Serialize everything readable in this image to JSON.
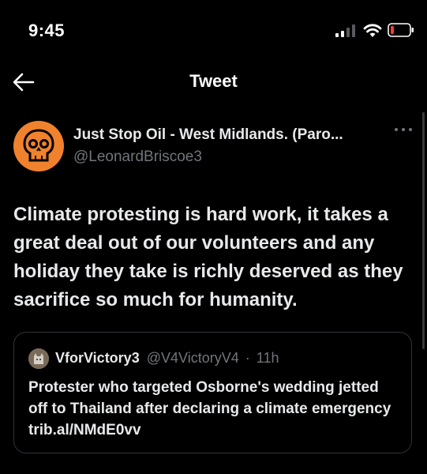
{
  "status_bar": {
    "time": "9:45"
  },
  "nav": {
    "title": "Tweet"
  },
  "tweet": {
    "author": {
      "name": "Just Stop Oil - West Midlands. (Paro...",
      "handle": "@LeonardBriscoe3"
    },
    "text": "Climate protesting is hard work, it takes a great deal out of our volunteers and any holiday they take is richly deserved as they sacrifice so much for humanity.",
    "quoted": {
      "name": "VforVictory3",
      "handle": "@V4VictoryV4",
      "separator": "·",
      "time": "11h",
      "text": "Protester who targeted Osborne's wedding jetted off to Thailand after declaring a climate emergency trib.al/NMdE0vv"
    }
  },
  "colors": {
    "avatar_bg": "#f0822d",
    "secondary_text": "#71767b",
    "border": "#2f3336",
    "battery_low": "#ff3b30"
  }
}
